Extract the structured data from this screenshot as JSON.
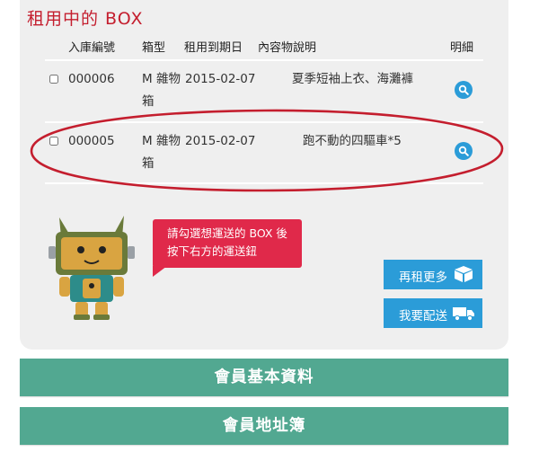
{
  "panel": {
    "title": "租用中的 BOX",
    "headers": [
      "入庫編號",
      "箱型",
      "租用到期日",
      "內容物說明",
      "明細"
    ]
  },
  "rows": [
    {
      "id": "000006",
      "box_line1": "M 雜物",
      "box_line2": "箱",
      "expiry": "2015-02-07",
      "description": "夏季短袖上衣、海灘褲",
      "checked": false
    },
    {
      "id": "000005",
      "box_line1": "M 雜物",
      "box_line2": "箱",
      "expiry": "2015-02-07",
      "description": "跑不動的四驅車*5",
      "checked": false
    }
  ],
  "bubble": {
    "line1": "請勾選想運送的 BOX 後",
    "line2": "按下右方的運送鈕"
  },
  "buttons": {
    "rent_more": "再租更多",
    "ship": "我要配送"
  },
  "nav": {
    "member_info": "會員基本資料",
    "address_book": "會員地址簿"
  },
  "icons": [
    "magnifier-icon",
    "box-icon",
    "truck-icon",
    "robot-mascot"
  ],
  "colors": {
    "title_red": "#c41e2e",
    "accent_blue": "#2b9cd8",
    "bubble_red": "#e0294a",
    "nav_green": "#52a891",
    "highlight_oval": "#c41e2e"
  }
}
